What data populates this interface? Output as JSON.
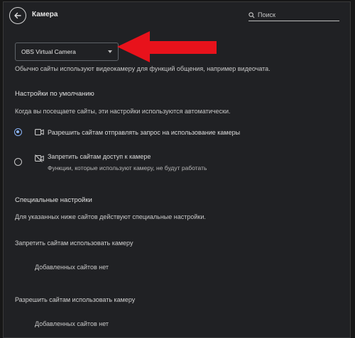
{
  "header": {
    "title": "Камера",
    "search_placeholder": "Поиск"
  },
  "camera_select": {
    "selected": "OBS Virtual Camera"
  },
  "camera_description": "Обычно сайты используют видеокамеру для функций общения, например видеочата.",
  "defaults": {
    "heading": "Настройки по умолчанию",
    "description": "Когда вы посещаете сайты, эти настройки используются автоматически.",
    "options": [
      {
        "label": "Разрешить сайтам отправлять запрос на использование камеры",
        "sublabel": "",
        "selected": true,
        "icon": "camera-icon"
      },
      {
        "label": "Запретить сайтам доступ к камере",
        "sublabel": "Функции, которые используют камеру, не будут работать",
        "selected": false,
        "icon": "camera-off-icon"
      }
    ]
  },
  "custom": {
    "heading": "Специальные настройки",
    "description": "Для указанных ниже сайтов действуют специальные настройки.",
    "blocked": {
      "heading": "Запретить сайтам использовать камеру",
      "empty": "Добавленных сайтов нет"
    },
    "allowed": {
      "heading": "Разрешить сайтам использовать камеру",
      "empty": "Добавленных сайтов нет"
    }
  },
  "colors": {
    "background": "#202124",
    "accent": "#8ab4f8",
    "arrow": "#e8121b"
  }
}
